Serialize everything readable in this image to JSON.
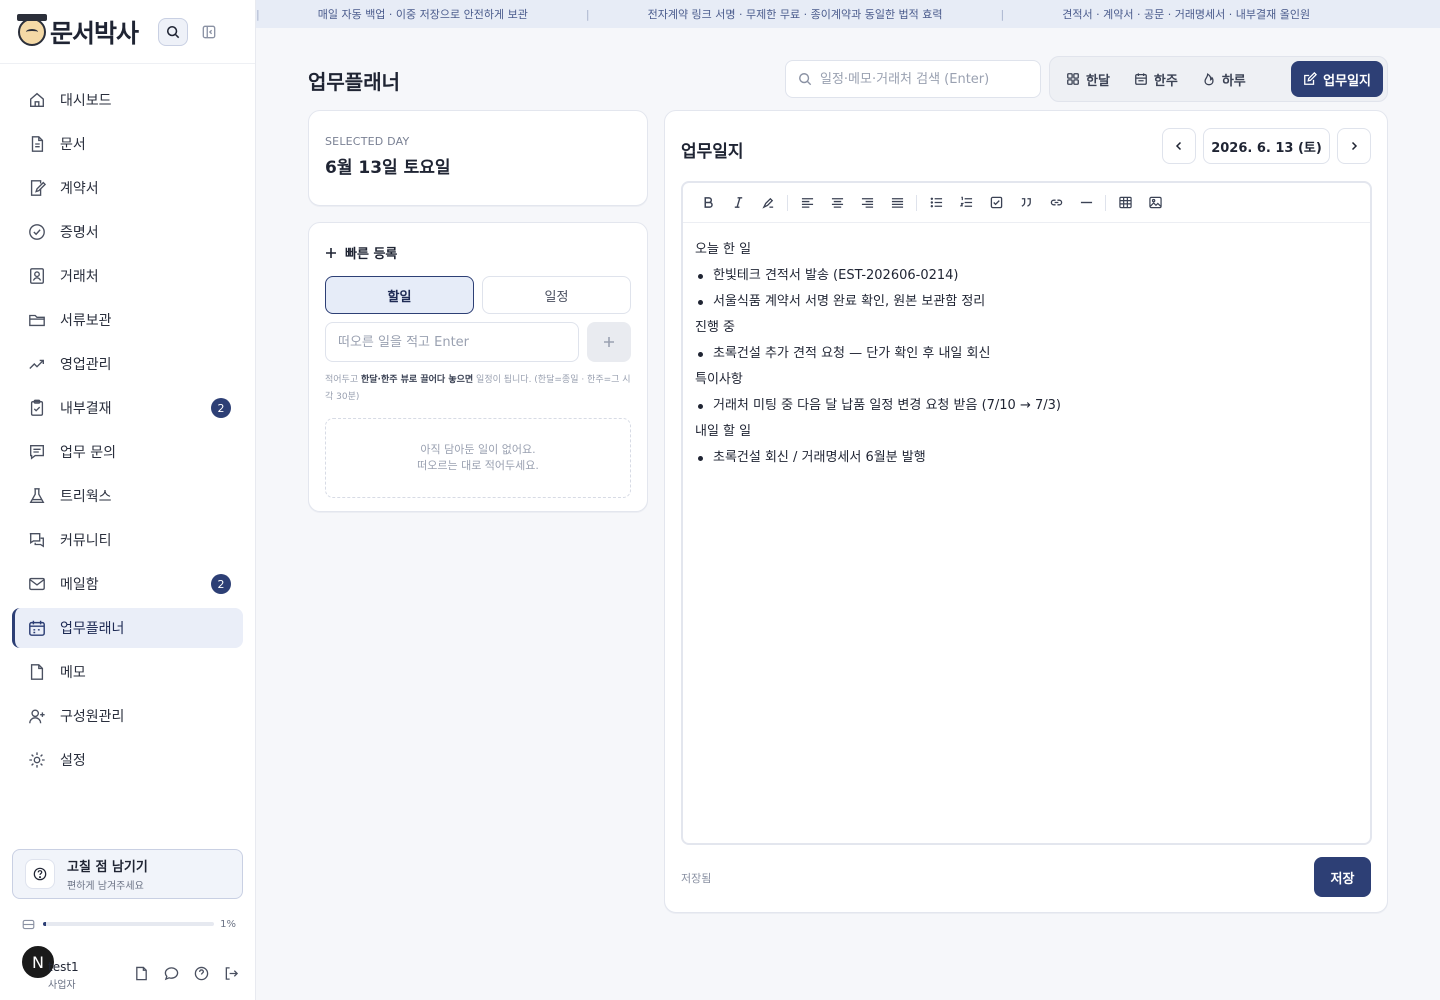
{
  "brand": {
    "name": "문서박사"
  },
  "nav": {
    "items": [
      {
        "label": "대시보드",
        "icon": "home-icon"
      },
      {
        "label": "문서",
        "icon": "document-icon"
      },
      {
        "label": "계약서",
        "icon": "contract-icon"
      },
      {
        "label": "증명서",
        "icon": "certificate-icon"
      },
      {
        "label": "거래처",
        "icon": "client-icon"
      },
      {
        "label": "서류보관",
        "icon": "folder-icon"
      },
      {
        "label": "영업관리",
        "icon": "trend-icon"
      },
      {
        "label": "내부결재",
        "icon": "clipboard-icon",
        "badge": "2"
      },
      {
        "label": "업무 문의",
        "icon": "message-icon"
      },
      {
        "label": "트리웍스",
        "icon": "flask-icon"
      },
      {
        "label": "커뮤니티",
        "icon": "chat-icon"
      },
      {
        "label": "메일함",
        "icon": "mail-icon",
        "badge": "2"
      },
      {
        "label": "업무플래너",
        "icon": "calendar-icon",
        "active": true
      },
      {
        "label": "메모",
        "icon": "memo-icon"
      },
      {
        "label": "구성원관리",
        "icon": "user-plus-icon"
      },
      {
        "label": "설정",
        "icon": "gear-icon"
      }
    ]
  },
  "feedback": {
    "title": "고칠 점 남기기",
    "subtitle": "편하게 남겨주세요"
  },
  "storage": {
    "percent_label": "1%",
    "fraction": 0.01
  },
  "user": {
    "avatar_letter": "N",
    "name": "test1",
    "role": "사업자"
  },
  "ticker": {
    "items": [
      "매일 자동 백업 · 이중 저장으로 안전하게 보관",
      "전자계약 링크 서명 · 무제한 무료 · 종이계약과 동일한 법적 효력",
      "견적서 · 계약서 · 공문 · 거래명세서 · 내부결재 올인원"
    ]
  },
  "header": {
    "title": "업무플래너",
    "search_placeholder": "일정·메모·거래처 검색 (Enter)",
    "view_tabs": [
      {
        "label": "한달",
        "icon": "grid-icon"
      },
      {
        "label": "한주",
        "icon": "week-calendar-icon"
      },
      {
        "label": "하루",
        "icon": "flame-icon"
      },
      {
        "label": "업무일지",
        "icon": "edit-note-icon",
        "active": true
      }
    ]
  },
  "selected_day": {
    "eyebrow": "SELECTED DAY",
    "title": "6월 13일 토요일"
  },
  "quick": {
    "title": "빠른 등록",
    "tab_todo": "할일",
    "tab_schedule": "일정",
    "input_placeholder": "떠오른 일을 적고 Enter",
    "hint_pre": "적어두고 ",
    "hint_bold": "한달·한주 뷰로 끌어다 놓으면",
    "hint_post": " 일정이 됩니다. (한달=종일 · 한주=그 시각 30분)",
    "empty_line1": "아직 담아둔 일이 없어요.",
    "empty_line2": "떠오르는 대로 적어두세요."
  },
  "journal": {
    "title": "업무일지",
    "date": "2026. 6. 13 (토)",
    "content": {
      "h1": "오늘 한 일",
      "h1_items": [
        "한빛테크 견적서 발송 (EST-202606-0214)",
        "서울식품 계약서 서명 완료 확인, 원본 보관함 정리"
      ],
      "h2": "진행 중",
      "h2_items": [
        "초록건설 추가 견적 요청 — 단가 확인 후 내일 회신"
      ],
      "h3": "특이사항",
      "h3_items": [
        "거래처 미팅 중 다음 달 납품 일정 변경 요청 받음 (7/10 → 7/3)"
      ],
      "h4": "내일 할 일",
      "h4_items": [
        "초록건설 회신 / 거래명세서 6월분 발행"
      ]
    },
    "status": "저장됨",
    "save_label": "저장"
  }
}
